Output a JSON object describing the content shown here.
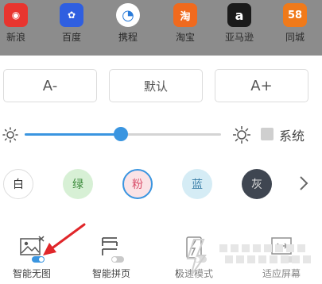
{
  "shortcuts": [
    {
      "label": "新浪",
      "icon": "weibo-icon",
      "color": "#e8352f",
      "glyph": "◉"
    },
    {
      "label": "百度",
      "icon": "baidu-paw-icon",
      "color": "#2f5fe0",
      "glyph": "✿"
    },
    {
      "label": "携程",
      "icon": "ctrip-dolphin-icon",
      "color": "#2a7bd9",
      "glyph": "◔"
    },
    {
      "label": "淘宝",
      "icon": "taobao-icon",
      "color": "#f06a1e",
      "glyph": "淘"
    },
    {
      "label": "亚马逊",
      "icon": "amazon-icon",
      "color": "#1a1a1a",
      "glyph": "a"
    },
    {
      "label": "同城",
      "icon": "58-tongcheng-icon",
      "color": "#f07a1a",
      "glyph": "58"
    }
  ],
  "font_size": {
    "decrease_label": "A-",
    "default_label": "默认",
    "increase_label": "A+"
  },
  "brightness": {
    "level": 0.49,
    "system_label": "系统",
    "system_checked": false
  },
  "background_colors": [
    {
      "label": "白",
      "fill": "#ffffff",
      "border": "#dddddd",
      "text": "#333333",
      "selected": false
    },
    {
      "label": "绿",
      "fill": "#d7f0d5",
      "border": "#d7f0d5",
      "text": "#3a8a3a",
      "selected": false
    },
    {
      "label": "粉",
      "fill": "#fbe3e6",
      "border": "#3a95e0",
      "text": "#d94f6a",
      "selected": true
    },
    {
      "label": "蓝",
      "fill": "#d5ecf5",
      "border": "#d5ecf5",
      "text": "#3b7fa8",
      "selected": false
    },
    {
      "label": "灰",
      "fill": "#3f4651",
      "border": "#3f4651",
      "text": "#e0e0e0",
      "selected": false
    }
  ],
  "tools": [
    {
      "label": "智能无图",
      "icon": "no-image-mode-icon",
      "enabled": true
    },
    {
      "label": "智能拼页",
      "icon": "page-join-icon",
      "enabled": false
    },
    {
      "label": "极速模式",
      "icon": "speed-mode-icon",
      "enabled": false
    },
    {
      "label": "适应屏幕",
      "icon": "fit-screen-icon",
      "enabled": false
    }
  ],
  "colors": {
    "accent": "#3a95e0",
    "annotation_arrow": "#e0262a",
    "dim_overlay": "#8c8c8c"
  }
}
